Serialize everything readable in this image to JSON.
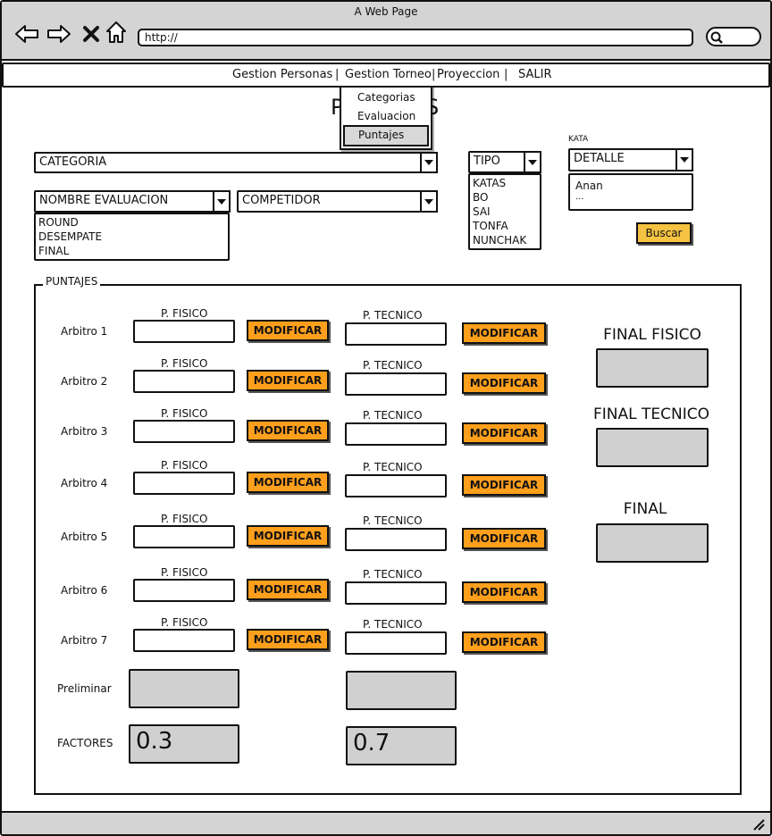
{
  "browser": {
    "title": "A Web Page",
    "url": "http://"
  },
  "menu": {
    "items": [
      "Gestion Personas",
      "Gestion Torneo",
      "Proyeccion",
      "SALIR"
    ],
    "separators": [
      "|",
      "|",
      "|"
    ],
    "dropdown": [
      "Categorias",
      "Evaluacion",
      "Puntajes"
    ]
  },
  "page": {
    "title_left": "P",
    "title_right": "S"
  },
  "filters": {
    "categoria": "CATEGORIA",
    "nombre_evaluacion": "NOMBRE EVALUACION",
    "evaluacion_options": [
      "ROUND",
      "DESEMPATE",
      "FINAL"
    ],
    "competidor": "COMPETIDOR",
    "tipo": "TIPO",
    "tipo_options": [
      "KATAS",
      "BO",
      "SAI",
      "TONFA",
      "NUNCHAK"
    ],
    "kata_label": "KATA",
    "detalle": "DETALLE",
    "kata_options": [
      "Anan",
      "..."
    ],
    "buscar": "Buscar"
  },
  "puntajes": {
    "group_label": "PUNTAJES",
    "fisico_label": "P. FISICO",
    "tecnico_label": "P. TECNICO",
    "modificar": "MODIFICAR",
    "arbitros": [
      "Arbitro 1",
      "Arbitro 2",
      "Arbitro 3",
      "Arbitro 4",
      "Arbitro 5",
      "Arbitro 6",
      "Arbitro 7"
    ],
    "preliminar_label": "Preliminar",
    "factores_label": "FACTORES",
    "factor_fisico": "0.3",
    "factor_tecnico": "0.7",
    "final_fisico": "FINAL FISICO",
    "final_tecnico": "FINAL TECNICO",
    "final": "FINAL"
  },
  "colors": {
    "button_orange": "#ff9f1c",
    "button_yellow": "#f5c242",
    "grey_box": "#d0d0d0",
    "chrome": "#d4d4d4"
  }
}
